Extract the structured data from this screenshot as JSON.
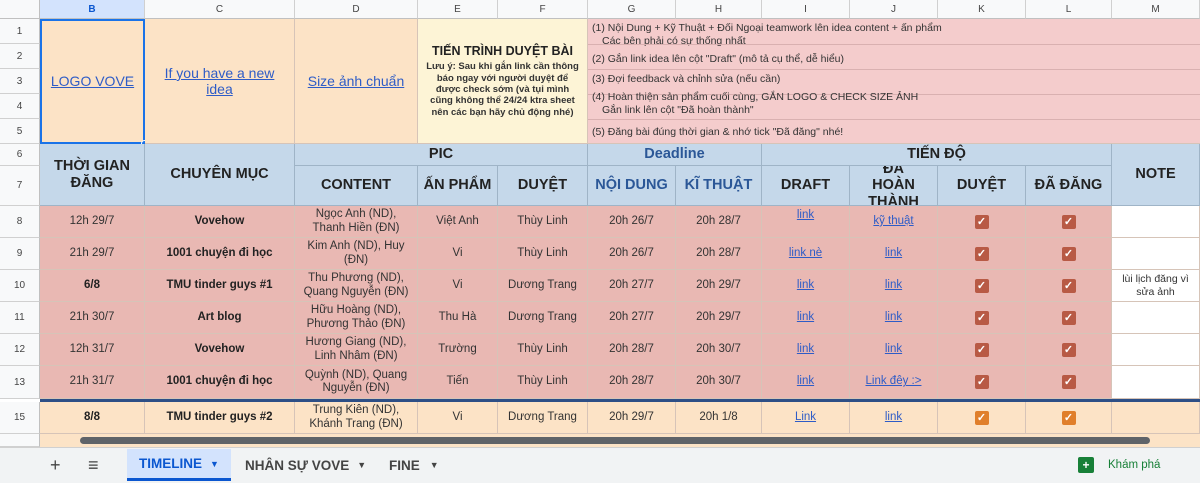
{
  "columns": [
    "B",
    "C",
    "D",
    "E",
    "F",
    "G",
    "H",
    "I",
    "J",
    "K",
    "L",
    "M"
  ],
  "row_numbers": [
    "1",
    "2",
    "3",
    "4",
    "5",
    "6",
    "7",
    "8",
    "9",
    "10",
    "11",
    "12",
    "13",
    "15"
  ],
  "top": {
    "logo_link": "LOGO VOVE",
    "idea_link": "If you have a new idea",
    "size_link": "Size ảnh chuẩn",
    "process_title": "TIẾN TRÌNH DUYỆT BÀI",
    "process_note": "Lưu ý: Sau khi gắn link cần thông báo ngay với người duyệt để được check sớm (và tụi mình cũng không thể 24/24 ktra sheet nên các bạn hãy chủ động nhé)",
    "steps": [
      "(1) Nội Dung + Kỹ Thuật + Đối Ngoại teamwork lên idea content + ấn phẩm",
      "Các bên phải có sự thống nhất",
      "(2) Gắn link idea lên cột \"Draft\" (mô tả cụ thể, dễ hiểu)",
      "(3) Đợi feedback và chỉnh sửa (nếu cần)",
      "(4) Hoàn thiện sản phẩm cuối cùng, GẮN LOGO & CHECK SIZE ẢNH",
      "Gắn link lên cột \"Đã hoàn thành\"",
      "(5) Đăng bài đúng thời gian & nhớ tick \"Đã đăng\" nhé!"
    ]
  },
  "headers": {
    "time": "THỜI GIAN ĐĂNG",
    "category": "CHUYÊN MỤC",
    "pic": "PIC",
    "deadline": "Deadline",
    "progress": "TIẾN ĐỘ",
    "note": "NOTE",
    "content": "CONTENT",
    "product": "ẤN PHẨM",
    "approve": "DUYỆT",
    "dl_content": "NỘI DUNG",
    "dl_tech": "KĨ THUẬT",
    "draft": "DRAFT",
    "done": "ĐÃ HOÀN THÀNH",
    "approved": "DUYỆT",
    "posted": "ĐÃ ĐĂNG"
  },
  "rows": [
    {
      "num": "8",
      "time": "12h 29/7",
      "category": "Vovehow",
      "content": "Ngọc Anh (ND), Thanh Hiền (ĐN)",
      "product": "Việt Anh",
      "approver": "Thùy Linh",
      "dl_content": "20h 26/7",
      "dl_tech": "20h 28/7",
      "draft": "link",
      "done": "kỹ thuật",
      "note": ""
    },
    {
      "num": "9",
      "time": "21h 29/7",
      "category": "1001 chuyện đi học",
      "content": "Kim Anh (ND), Huy (ĐN)",
      "product": "Vi",
      "approver": "Thùy Linh",
      "dl_content": "20h 26/7",
      "dl_tech": "20h 28/7",
      "draft": "link nè",
      "done": "link",
      "note": ""
    },
    {
      "num": "10",
      "time": "6/8",
      "category": "TMU tinder guys #1",
      "content": "Thu Phương (ND), Quang Nguyễn (ĐN)",
      "product": "Vi",
      "approver": "Dương Trang",
      "dl_content": "20h 27/7",
      "dl_tech": "20h 29/7",
      "draft": "link",
      "done": "link",
      "note": "lùi lịch đăng vì sửa ảnh"
    },
    {
      "num": "11",
      "time": "21h 30/7",
      "category": "Art blog",
      "content": "Hữu Hoàng (ND), Phương Thảo (ĐN)",
      "product": "Thu Hà",
      "approver": "Dương Trang",
      "dl_content": "20h 27/7",
      "dl_tech": "20h 29/7",
      "draft": "link",
      "done": "link",
      "note": ""
    },
    {
      "num": "12",
      "time": "12h 31/7",
      "category": "Vovehow",
      "content": "Hương Giang (ND), Linh Nhâm (ĐN)",
      "product": "Trường",
      "approver": "Thùy Linh",
      "dl_content": "20h 28/7",
      "dl_tech": "20h 30/7",
      "draft": "link",
      "done": "link",
      "note": ""
    },
    {
      "num": "13",
      "time": "21h 31/7",
      "category": "1001 chuyện đi học",
      "content": "Quỳnh (ND), Quang Nguyễn (ĐN)",
      "product": "Tiến",
      "approver": "Thùy Linh",
      "dl_content": "20h 28/7",
      "dl_tech": "20h 30/7",
      "draft": "link",
      "done": "Link đêy :>",
      "note": ""
    },
    {
      "num": "15",
      "time": "8/8",
      "category": "TMU tinder guys #2",
      "content": "Trung Kiên (ND), Khánh Trang (ĐN)",
      "product": "Vi",
      "approver": "Dương Trang",
      "dl_content": "20h 29/7",
      "dl_tech": "20h 1/8",
      "draft": "Link",
      "done": "link",
      "note": ""
    }
  ],
  "tabs": {
    "add": "+",
    "menu": "≡",
    "t1": "TIMELINE",
    "t2": "NHÂN SỰ VOVE",
    "t3": "FINE",
    "explore": "Khám phá"
  },
  "colors": {
    "row_pink": "#e9b8b3",
    "row_peach": "#fce3c6",
    "header_blue": "#c5d8ea",
    "checkbox": "#b85a45",
    "checkbox_orange": "#e07f2b"
  }
}
